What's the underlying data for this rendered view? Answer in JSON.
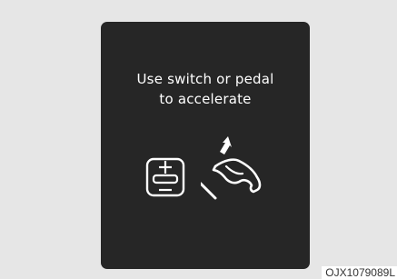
{
  "display": {
    "message_line1": "Use switch or pedal",
    "message_line2": "to accelerate"
  },
  "icons": {
    "switch": "accelerator-switch-icon",
    "pedal": "accelerator-pedal-icon"
  },
  "caption": {
    "image_code": "OJX1079089L"
  },
  "colors": {
    "panel_background": "#262626",
    "frame_background": "#e6e6e6",
    "text": "#ffffff",
    "icon": "#ffffff"
  }
}
